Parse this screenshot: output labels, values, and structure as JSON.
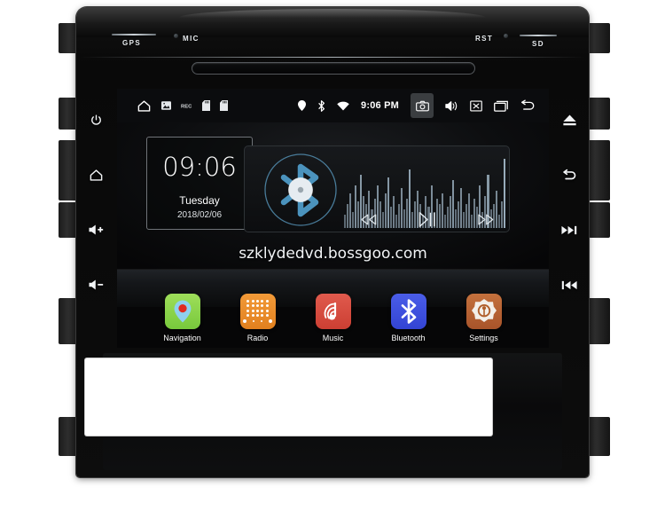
{
  "product": {
    "name": "Android car head unit",
    "bezel_labels": {
      "gps": "GPS",
      "mic": "MIC",
      "rst": "RST",
      "sd": "SD"
    }
  },
  "hard_keys": {
    "left": [
      {
        "name": "power-button",
        "label": "Power"
      },
      {
        "name": "home-button",
        "label": "Home"
      },
      {
        "name": "volume-up-button",
        "label": "Volume Up"
      },
      {
        "name": "volume-down-button",
        "label": "Volume Down"
      }
    ],
    "right": [
      {
        "name": "eject-button",
        "label": "Eject"
      },
      {
        "name": "back-button",
        "label": "Back"
      },
      {
        "name": "next-track-button",
        "label": "Next Track"
      },
      {
        "name": "previous-track-button",
        "label": "Previous Track"
      }
    ]
  },
  "statusbar": {
    "time": "9:06 PM",
    "left_icons": [
      "home-icon",
      "screenshot-icon",
      "rec-icon",
      "sdcard-icon",
      "sdcard2-icon"
    ],
    "right_icons": [
      "location-icon",
      "bluetooth-icon",
      "wifi-icon"
    ],
    "action_icons": [
      "camera-icon",
      "volume-icon",
      "close-icon",
      "recents-icon",
      "back-icon"
    ],
    "camera_highlight_color": "#3a3d40"
  },
  "clock_widget": {
    "time": "09:06",
    "day": "Tuesday",
    "date": "2018/02/06"
  },
  "music_widget": {
    "source_icon": "bluetooth-disc-icon",
    "controls": [
      "previous-icon",
      "play-pause-icon",
      "next-icon"
    ],
    "equalizer_levels": [
      5,
      9,
      13,
      6,
      16,
      10,
      20,
      12,
      9,
      14,
      7,
      11,
      16,
      10,
      6,
      13,
      19,
      8,
      12,
      5,
      9,
      15,
      7,
      11,
      22,
      6,
      10,
      14,
      9,
      5,
      12,
      8,
      16,
      6,
      11,
      9,
      13,
      5,
      8,
      12,
      18,
      7,
      10,
      15,
      6,
      9,
      13,
      5,
      11,
      8,
      16,
      6,
      12,
      20,
      7,
      9,
      14,
      5,
      10,
      26
    ],
    "accent_color": "#5b9ec4"
  },
  "watermark": {
    "text": "szklydedvd.bossgoo.com"
  },
  "dock": {
    "apps": [
      {
        "label": "Navigation",
        "icon": "map-pin-icon",
        "color": "#78c93c"
      },
      {
        "label": "Radio",
        "icon": "radio-grid-icon",
        "color": "#e1801f"
      },
      {
        "label": "Music",
        "icon": "music-note-icon",
        "color": "#cc3f33"
      },
      {
        "label": "Bluetooth",
        "icon": "bluetooth-icon",
        "color": "#3344d4"
      },
      {
        "label": "Settings",
        "icon": "gear-icon",
        "color": "#a8542a"
      }
    ]
  }
}
